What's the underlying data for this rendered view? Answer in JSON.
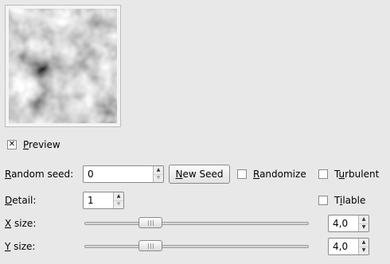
{
  "preview": {
    "label_mnemonic": "P",
    "label_rest": "review",
    "checked_mark": "✕"
  },
  "random_seed": {
    "label_mnemonic": "R",
    "label_rest": "andom seed:",
    "value": "0"
  },
  "new_seed_button": {
    "label_mnemonic": "N",
    "label_rest": "ew Seed"
  },
  "randomize": {
    "label_mnemonic": "R",
    "label_rest": "andomize",
    "checked": false
  },
  "turbulent": {
    "label_mnemonic": "u",
    "label_before": "T",
    "label_rest": "rbulent",
    "checked": false
  },
  "detail": {
    "label_mnemonic": "D",
    "label_rest": "etail:",
    "value": "1"
  },
  "tilable": {
    "label_mnemonic": "i",
    "label_before": "T",
    "label_rest": "lable",
    "checked": false
  },
  "x_size": {
    "label_mnemonic": "X",
    "label_rest": " size:",
    "value": "4,0",
    "slider_fraction": 0.27
  },
  "y_size": {
    "label_mnemonic": "Y",
    "label_rest": " size:",
    "value": "4,0",
    "slider_fraction": 0.27
  },
  "icons": {
    "spin_up": "▲",
    "spin_down": "▼"
  }
}
